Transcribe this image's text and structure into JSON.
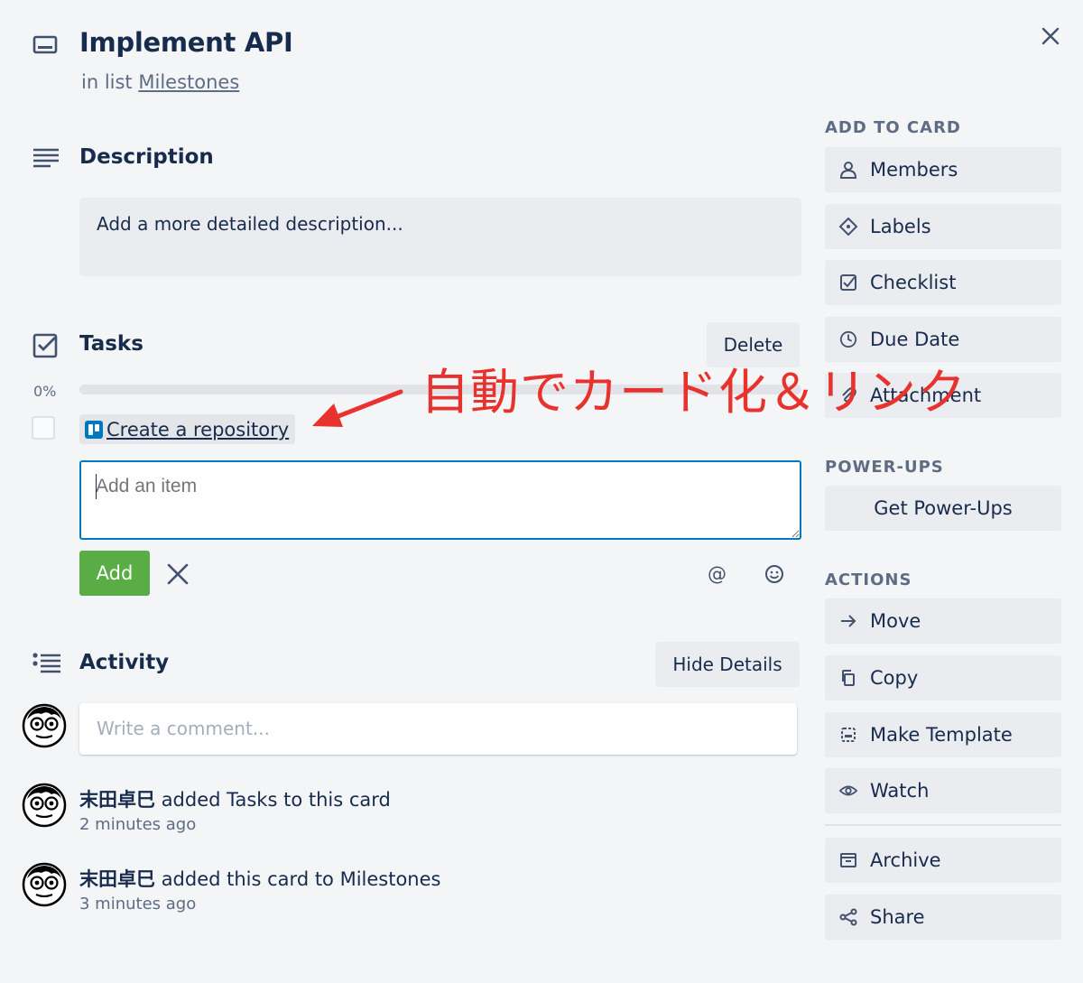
{
  "card": {
    "title": "Implement API",
    "list_prefix": "in list",
    "list_name": "Milestones"
  },
  "description": {
    "title": "Description",
    "placeholder": "Add a more detailed description..."
  },
  "tasks": {
    "title": "Tasks",
    "delete_label": "Delete",
    "progress_text": "0%",
    "progress_value": 0,
    "items": [
      {
        "label": "Create a repository",
        "checked": false
      }
    ],
    "add_item_placeholder": "Add an item",
    "add_label": "Add"
  },
  "annotation": {
    "text": "自動でカード化＆リンク",
    "color": "#e8322d"
  },
  "activity": {
    "title": "Activity",
    "hide_details_label": "Hide Details",
    "comment_placeholder": "Write a comment...",
    "entries": [
      {
        "user": "末田卓巳",
        "action": "added Tasks to this card",
        "time": "2 minutes ago"
      },
      {
        "user": "末田卓巳",
        "action": "added this card to Milestones",
        "time": "3 minutes ago"
      }
    ]
  },
  "sidebar": {
    "add_to_card": {
      "heading": "ADD TO CARD",
      "items": [
        {
          "label": "Members",
          "icon": "person-icon"
        },
        {
          "label": "Labels",
          "icon": "tag-icon"
        },
        {
          "label": "Checklist",
          "icon": "checkbox-icon"
        },
        {
          "label": "Due Date",
          "icon": "clock-icon"
        },
        {
          "label": "Attachment",
          "icon": "paperclip-icon"
        }
      ]
    },
    "power_ups": {
      "heading": "POWER-UPS",
      "items": [
        {
          "label": "Get Power-Ups"
        }
      ]
    },
    "actions": {
      "heading": "ACTIONS",
      "items": [
        {
          "label": "Move",
          "icon": "arrow-right-icon"
        },
        {
          "label": "Copy",
          "icon": "copy-icon"
        },
        {
          "label": "Make Template",
          "icon": "template-icon"
        },
        {
          "label": "Watch",
          "icon": "eye-icon"
        },
        {
          "label": "Archive",
          "icon": "archive-icon"
        },
        {
          "label": "Share",
          "icon": "share-icon"
        }
      ]
    }
  },
  "colors": {
    "accent": "#0079bf",
    "add_button": "#5aac44",
    "background": "#f4f5f7",
    "button_bg": "#ebecf0",
    "text": "#172b4d",
    "muted": "#5e6c84"
  }
}
